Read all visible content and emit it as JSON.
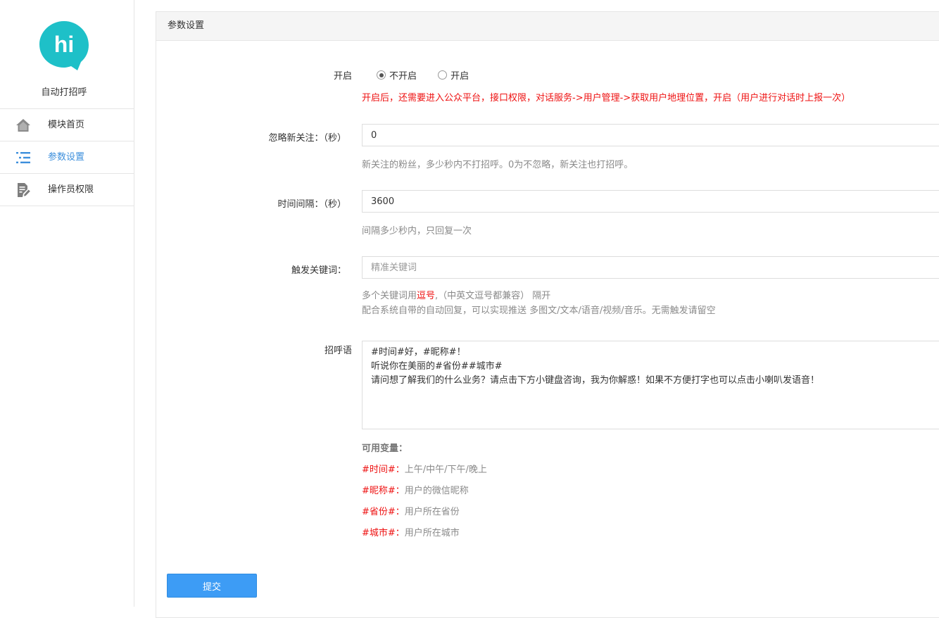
{
  "sidebar": {
    "logo_text": "hi",
    "app_title": "自动打招呼",
    "items": [
      {
        "label": "模块首页",
        "icon": "home-icon",
        "active": false
      },
      {
        "label": "参数设置",
        "icon": "list-icon",
        "active": true
      },
      {
        "label": "操作员权限",
        "icon": "document-edit-icon",
        "active": false
      }
    ]
  },
  "panel": {
    "title": "参数设置"
  },
  "form": {
    "enable": {
      "label": "开启",
      "options": [
        "不开启",
        "开启"
      ],
      "selected": "不开启",
      "warning": "开启后，还需要进入公众平台，接口权限，对话服务->用户管理->获取用户地理位置，开启（用户进行对话时上报一次）"
    },
    "ignore_new": {
      "label": "忽略新关注：（秒）",
      "value": "0",
      "help": "新关注的粉丝，多少秒内不打招呼。0为不忽略，新关注也打招呼。"
    },
    "interval": {
      "label": "时间间隔：（秒）",
      "value": "3600",
      "help": "间隔多少秒内，只回复一次"
    },
    "keyword": {
      "label": "触发关键词：",
      "value": "",
      "placeholder": "精准关键词",
      "help_prefix": "多个关键词用",
      "help_red": "逗号",
      "help_suffix": ",（中英文逗号都兼容） 隔开",
      "help_line2": "配合系统自带的自动回复，可以实现推送 多图文/文本/语音/视频/音乐。无需触发请留空"
    },
    "greeting": {
      "label": "招呼语",
      "value": "#时间#好，#昵称#！\n听说你在美丽的#省份##城市#\n请问想了解我们的什么业务？请点击下方小键盘咨询，我为你解惑！如果不方便打字也可以点击小喇叭发语音！",
      "vars_title": "可用变量：",
      "vars": [
        {
          "name": "#时间#：",
          "desc": "上午/中午/下午/晚上"
        },
        {
          "name": "#昵称#：",
          "desc": "用户的微信昵称"
        },
        {
          "name": "#省份#：",
          "desc": "用户所在省份"
        },
        {
          "name": "#城市#：",
          "desc": "用户所在城市"
        }
      ]
    },
    "submit_label": "提交"
  },
  "colors": {
    "accent": "#3d8fdc",
    "button": "#3d9cf5",
    "warning": "#ee1111",
    "logo": "#1ec0c8"
  }
}
